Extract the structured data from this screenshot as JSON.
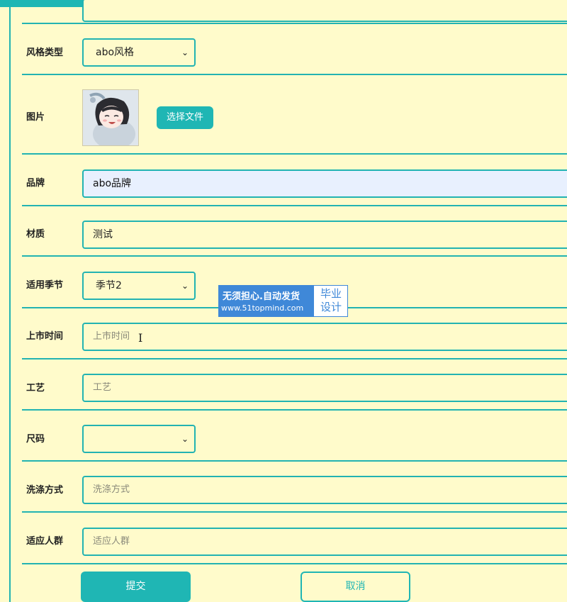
{
  "form": {
    "style_type": {
      "label": "风格类型",
      "value": "abo风格"
    },
    "image": {
      "label": "图片",
      "choose_file_label": "选择文件"
    },
    "brand": {
      "label": "品牌",
      "value": "abo品牌"
    },
    "material": {
      "label": "材质",
      "value": "测试"
    },
    "season": {
      "label": "适用季节",
      "value": "季节2"
    },
    "launch_time": {
      "label": "上市时间",
      "placeholder": "上市时间"
    },
    "craft": {
      "label": "工艺",
      "placeholder": "工艺"
    },
    "size": {
      "label": "尺码",
      "value": ""
    },
    "wash_method": {
      "label": "洗涤方式",
      "placeholder": "洗涤方式"
    },
    "target_group": {
      "label": "适应人群",
      "placeholder": "适应人群"
    }
  },
  "actions": {
    "submit_label": "提交",
    "cancel_label": "取消"
  },
  "watermark": {
    "line1": "无须担心.自动发货",
    "line2": "www.51topmind.com",
    "side_line1": "毕业",
    "side_line2": "设计"
  },
  "colors": {
    "accent": "#1fb6b4",
    "background": "#fffbcb",
    "focused_input": "#e8f0fe",
    "watermark_blue": "#3f88d8"
  },
  "icons": {
    "select_chevron": "chevron-down-icon",
    "text_cursor": "i-beam-cursor-icon"
  }
}
